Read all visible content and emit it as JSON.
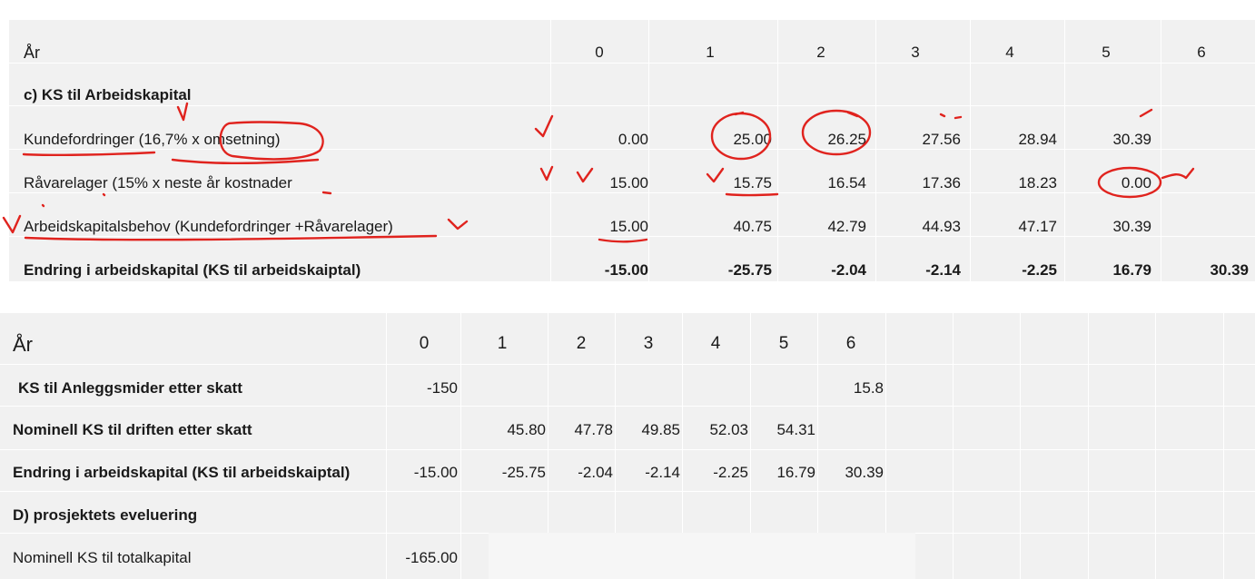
{
  "table1": {
    "header": {
      "label": "År",
      "years": [
        "0",
        "1",
        "2",
        "3",
        "4",
        "5",
        "6"
      ]
    },
    "section_title": "c) KS til Arbeidskapital",
    "rows": [
      {
        "label": "Kundefordringer (16,7% x omsetning)",
        "values": [
          "0.00",
          "25.00",
          "26.25",
          "27.56",
          "28.94",
          "30.39",
          ""
        ]
      },
      {
        "label": "Råvarelager (15% x neste år kostnader",
        "values": [
          "15.00",
          "15.75",
          "16.54",
          "17.36",
          "18.23",
          "0.00",
          ""
        ]
      },
      {
        "label": "Arbeidskapitalsbehov (Kundefordringer +Råvarelager)",
        "values": [
          "15.00",
          "40.75",
          "42.79",
          "44.93",
          "47.17",
          "30.39",
          ""
        ]
      },
      {
        "label": "Endring i arbeidskapital (KS til arbeidskaiptal)",
        "values": [
          "-15.00",
          "-25.75",
          "-2.04",
          "-2.14",
          "-2.25",
          "16.79",
          "30.39"
        ]
      }
    ]
  },
  "table2": {
    "header": {
      "label": "År",
      "years": [
        "0",
        "1",
        "2",
        "3",
        "4",
        "5",
        "6"
      ]
    },
    "rows": [
      {
        "label": "KS til Anleggsmider etter skatt",
        "values": [
          "-150",
          "",
          "",
          "",
          "",
          "",
          "15.8"
        ]
      },
      {
        "label": "Nominell KS til driften etter skatt",
        "values": [
          "",
          "45.80",
          "47.78",
          "49.85",
          "52.03",
          "54.31",
          ""
        ]
      },
      {
        "label": "Endring i arbeidskapital (KS til arbeidskaiptal)",
        "values": [
          "-15.00",
          "-25.75",
          "-2.04",
          "-2.14",
          "-2.25",
          "16.79",
          "30.39"
        ]
      },
      {
        "label": "D) prosjektets eveluering",
        "values": [
          "",
          "",
          "",
          "",
          "",
          "",
          ""
        ]
      },
      {
        "label": "Nominell KS til totalkapital",
        "values": [
          "-165.00",
          "",
          "",
          "",
          "",
          "",
          ""
        ]
      }
    ]
  },
  "colors": {
    "cell_background": "#f1f1f1",
    "grid_line": "#ffffff",
    "ink": "#e0231e",
    "text": "#1a1a1a"
  }
}
